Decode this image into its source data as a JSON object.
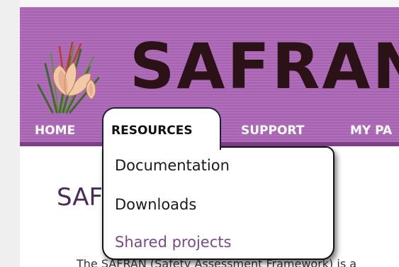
{
  "site": {
    "title": "SAFRAN",
    "logo_icon": "saffron-flower-icon"
  },
  "nav": {
    "items": [
      {
        "label": "HOME"
      },
      {
        "label": "RESOURCES"
      },
      {
        "label": "SUPPORT"
      },
      {
        "label": "MY PA"
      }
    ],
    "active": "RESOURCES"
  },
  "dropdown": {
    "items": [
      {
        "label": "Documentation"
      },
      {
        "label": "Downloads"
      },
      {
        "label": "Shared projects"
      }
    ]
  },
  "main": {
    "heading": "SAF",
    "body": "The SAFRAN (Safety Assessment Framework) is a"
  },
  "colors": {
    "banner": "#b06fb9",
    "title": "#2a1216",
    "nav_text": "#ffffff",
    "heading": "#4a2a5a",
    "dropdown_link_visited": "#7a4a88"
  }
}
